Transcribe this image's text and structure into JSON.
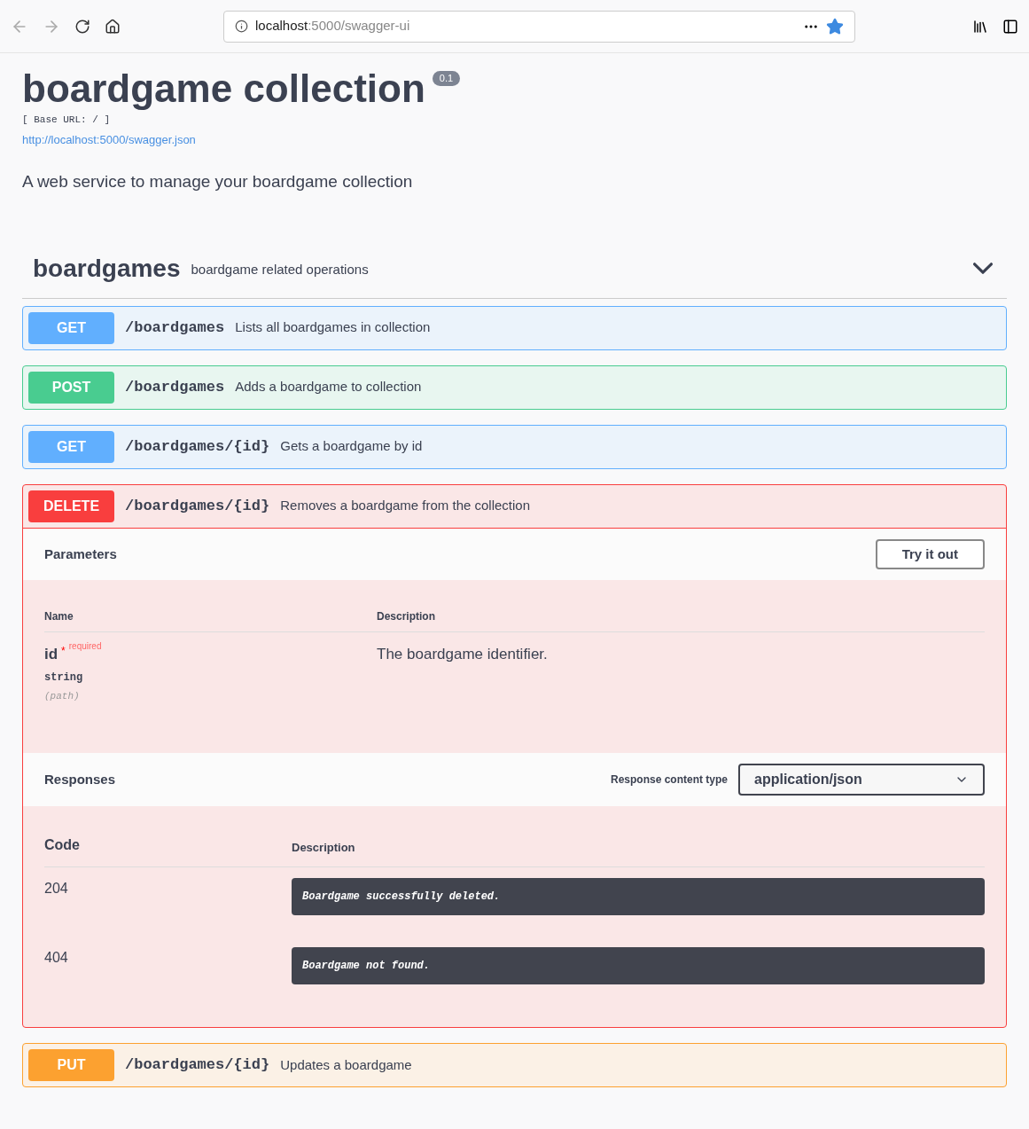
{
  "browser": {
    "url_host": "localhost",
    "url_path": ":5000/swagger-ui"
  },
  "info": {
    "title": "boardgame collection",
    "version": "0.1",
    "base_url": "[ Base URL: / ]",
    "spec_link": "http://localhost:5000/swagger.json",
    "description": "A web service to manage your boardgame collection"
  },
  "tag": {
    "name": "boardgames",
    "description": "boardgame related operations",
    "expanded": true
  },
  "operations": [
    {
      "method": "GET",
      "path": "/boardgames",
      "summary": "Lists all boardgames in collection",
      "expanded": false
    },
    {
      "method": "POST",
      "path": "/boardgames",
      "summary": "Adds a boardgame to collection",
      "expanded": false
    },
    {
      "method": "GET",
      "path": "/boardgames/{id}",
      "summary": "Gets a boardgame by id",
      "expanded": false
    },
    {
      "method": "DELETE",
      "path": "/boardgames/{id}",
      "summary": "Removes a boardgame from the collection",
      "expanded": true,
      "details": {
        "parameters_title": "Parameters",
        "try_button": "Try it out",
        "param_columns": [
          "Name",
          "Description"
        ],
        "params": [
          {
            "name": "id",
            "required_mark": "*",
            "required": "required",
            "type": "string",
            "in": "(path)",
            "description": "The boardgame identifier."
          }
        ],
        "responses_title": "Responses",
        "content_type_label": "Response content type",
        "content_type": "application/json",
        "response_columns": [
          "Code",
          "Description"
        ],
        "responses": [
          {
            "code": "204",
            "description": "Boardgame successfully deleted."
          },
          {
            "code": "404",
            "description": "Boardgame not found."
          }
        ]
      }
    },
    {
      "method": "PUT",
      "path": "/boardgames/{id}",
      "summary": "Updates a boardgame",
      "expanded": false
    }
  ]
}
